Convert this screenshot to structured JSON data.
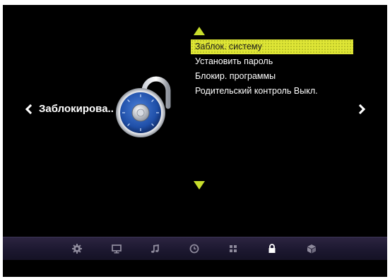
{
  "section": {
    "title": "Заблокирова.."
  },
  "menu": {
    "items": [
      {
        "label": "Заблок. систему",
        "selected": true
      },
      {
        "label": "Установить пароль",
        "selected": false
      },
      {
        "label": "Блокир. программы",
        "selected": false
      },
      {
        "label": "Родительский контроль Выкл.",
        "selected": false
      }
    ]
  },
  "bottom_nav": [
    {
      "icon": "gear-icon",
      "active": false
    },
    {
      "icon": "monitor-icon",
      "active": false
    },
    {
      "icon": "music-note-icon",
      "active": false
    },
    {
      "icon": "clock-icon",
      "active": false
    },
    {
      "icon": "grid-icon",
      "active": false
    },
    {
      "icon": "lock-icon",
      "active": true
    },
    {
      "icon": "cube-icon",
      "active": false
    }
  ],
  "colors": {
    "accent": "#dfe636",
    "arrow": "#c8de2c",
    "background": "#000000",
    "text": "#ffffff"
  }
}
